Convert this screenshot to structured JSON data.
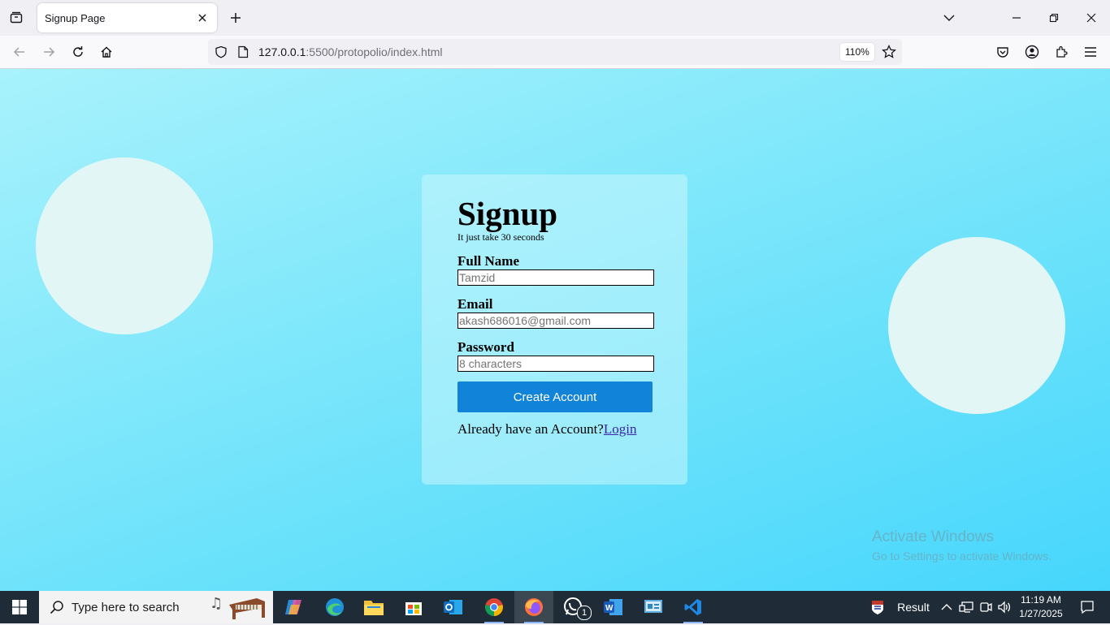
{
  "browser": {
    "tab_title": "Signup Page",
    "url_host": "127.0.0.1",
    "url_rest": ":5500/protopolio/index.html",
    "zoom": "110%"
  },
  "page": {
    "heading": "Signup",
    "subtitle": "It just take 30 seconds",
    "fields": [
      {
        "label": "Full Name",
        "placeholder": "Tamzid"
      },
      {
        "label": "Email",
        "placeholder": "akash686016@gmail.com"
      },
      {
        "label": "Password",
        "placeholder": "8 characters"
      }
    ],
    "create_button": "Create Account",
    "login_prompt": "Already have an Account?",
    "login_link": "Login"
  },
  "watermark": {
    "title": "Activate Windows",
    "subtitle": "Go to Settings to activate Windows."
  },
  "taskbar": {
    "search_placeholder": "Type here to search",
    "widget_label": "Result",
    "whatsapp_badge": "1",
    "time": "11:19 AM",
    "date": "1/27/2025"
  },
  "colors": {
    "accent_button": "#1183d8",
    "circle": "#e2f6f6",
    "taskbar": "#1f2c37"
  }
}
